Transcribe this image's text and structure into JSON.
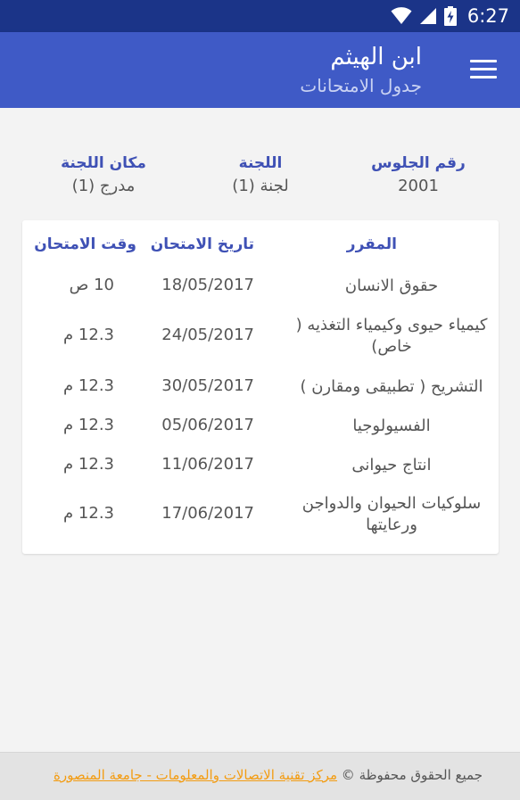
{
  "status": {
    "time": "6:27"
  },
  "header": {
    "title": "ابن الهيثم",
    "subtitle": "جدول الامتحانات"
  },
  "info": {
    "seat_label": "رقم الجلوس",
    "seat_value": "2001",
    "committee_label": "اللجنة",
    "committee_value": "لجنة (1)",
    "location_label": "مكان اللجنة",
    "location_value": "مدرج (1)"
  },
  "table": {
    "headers": {
      "course": "المقرر",
      "date": "تاريخ الامتحان",
      "time": "وقت الامتحان"
    },
    "rows": [
      {
        "course": "حقوق الانسان",
        "date": "18/05/2017",
        "time": "10 ص"
      },
      {
        "course": "كيمياء حيوى وكيمياء التغذيه ( خاص)",
        "date": "24/05/2017",
        "time": "12.3 م"
      },
      {
        "course": "التشريح ( تطبيقى ومقارن )",
        "date": "30/05/2017",
        "time": "12.3 م"
      },
      {
        "course": "الفسيولوجيا",
        "date": "05/06/2017",
        "time": "12.3 م"
      },
      {
        "course": "انتاج حيوانى",
        "date": "11/06/2017",
        "time": "12.3 م"
      },
      {
        "course": "سلوكيات الحيوان والدواجن ورعايتها",
        "date": "17/06/2017",
        "time": "12.3 م"
      }
    ]
  },
  "footer": {
    "text": "جميع الحقوق محفوظة ©",
    "link": "مركز تقنية الاتصالات والمعلومات - جامعة المنصورة"
  },
  "colors": {
    "status_bar": "#1b3488",
    "app_bar": "#3f5ac6",
    "accent": "#3f51b5",
    "link": "#f39c12"
  }
}
